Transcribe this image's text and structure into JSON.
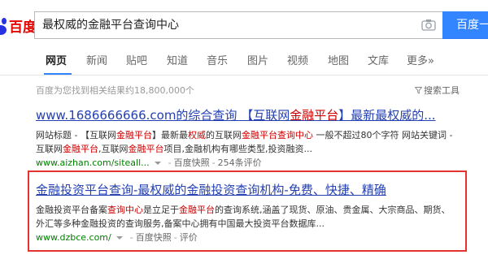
{
  "header": {
    "logo_text": "百度",
    "search_query": "最权威的金融平台查询中心",
    "search_button": "百度一"
  },
  "tabs": [
    {
      "label": "网页",
      "active": true
    },
    {
      "label": "新闻"
    },
    {
      "label": "贴吧"
    },
    {
      "label": "知道"
    },
    {
      "label": "音乐"
    },
    {
      "label": "图片"
    },
    {
      "label": "视频"
    },
    {
      "label": "地图"
    },
    {
      "label": "文库"
    },
    {
      "label": "更多»"
    }
  ],
  "result_count": "百度为您找到相关结果约18,800,000个",
  "search_tools": "搜索工具",
  "results": [
    {
      "title_pre": "www.1686666666.com的综合查询 【互联网",
      "title_em": "金融平台",
      "title_post": "】最新最权威的...",
      "snippet": [
        {
          "t": "网站标题 - 【互联网"
        },
        {
          "t": "金融平台",
          "em": true
        },
        {
          "t": "】最新最"
        },
        {
          "t": "权威",
          "em": true
        },
        {
          "t": "的互联网"
        },
        {
          "t": "金融平台查询中心",
          "em": true
        },
        {
          "t": " 一般不超过80个字符 网站关键词 - 互联网"
        },
        {
          "t": "金融平台",
          "em": true
        },
        {
          "t": ",互联网"
        },
        {
          "t": "金融平台",
          "em": true
        },
        {
          "t": "项目,金融机构有哪些类型,投资融资..."
        }
      ],
      "url": "www.aizhan.com/siteall...",
      "snapshot": "百度快照",
      "reviews": "254条评价"
    },
    {
      "title_pre": "金融投资平台查询-最权威的金融投资查询机构-免费、快捷、精确",
      "title_em": "",
      "title_post": "",
      "snippet": [
        {
          "t": "金融投资平台备案"
        },
        {
          "t": "查询中心",
          "em": true
        },
        {
          "t": "是立足于"
        },
        {
          "t": "金融平台",
          "em": true
        },
        {
          "t": "的查询系统,涵盖了现货、原油、贵金属、大宗商品、期货、外汇等多种金融投资的查询服务,备案中心拥有中国最大投资平台数据库..."
        }
      ],
      "url": "www.dzbce.com/",
      "snapshot": "百度快照",
      "reviews": "评价"
    }
  ],
  "colors": {
    "brand_blue": "#3385ff",
    "title_link": "#2440b3",
    "highlight_red": "#e53333",
    "url_green": "#008000"
  }
}
